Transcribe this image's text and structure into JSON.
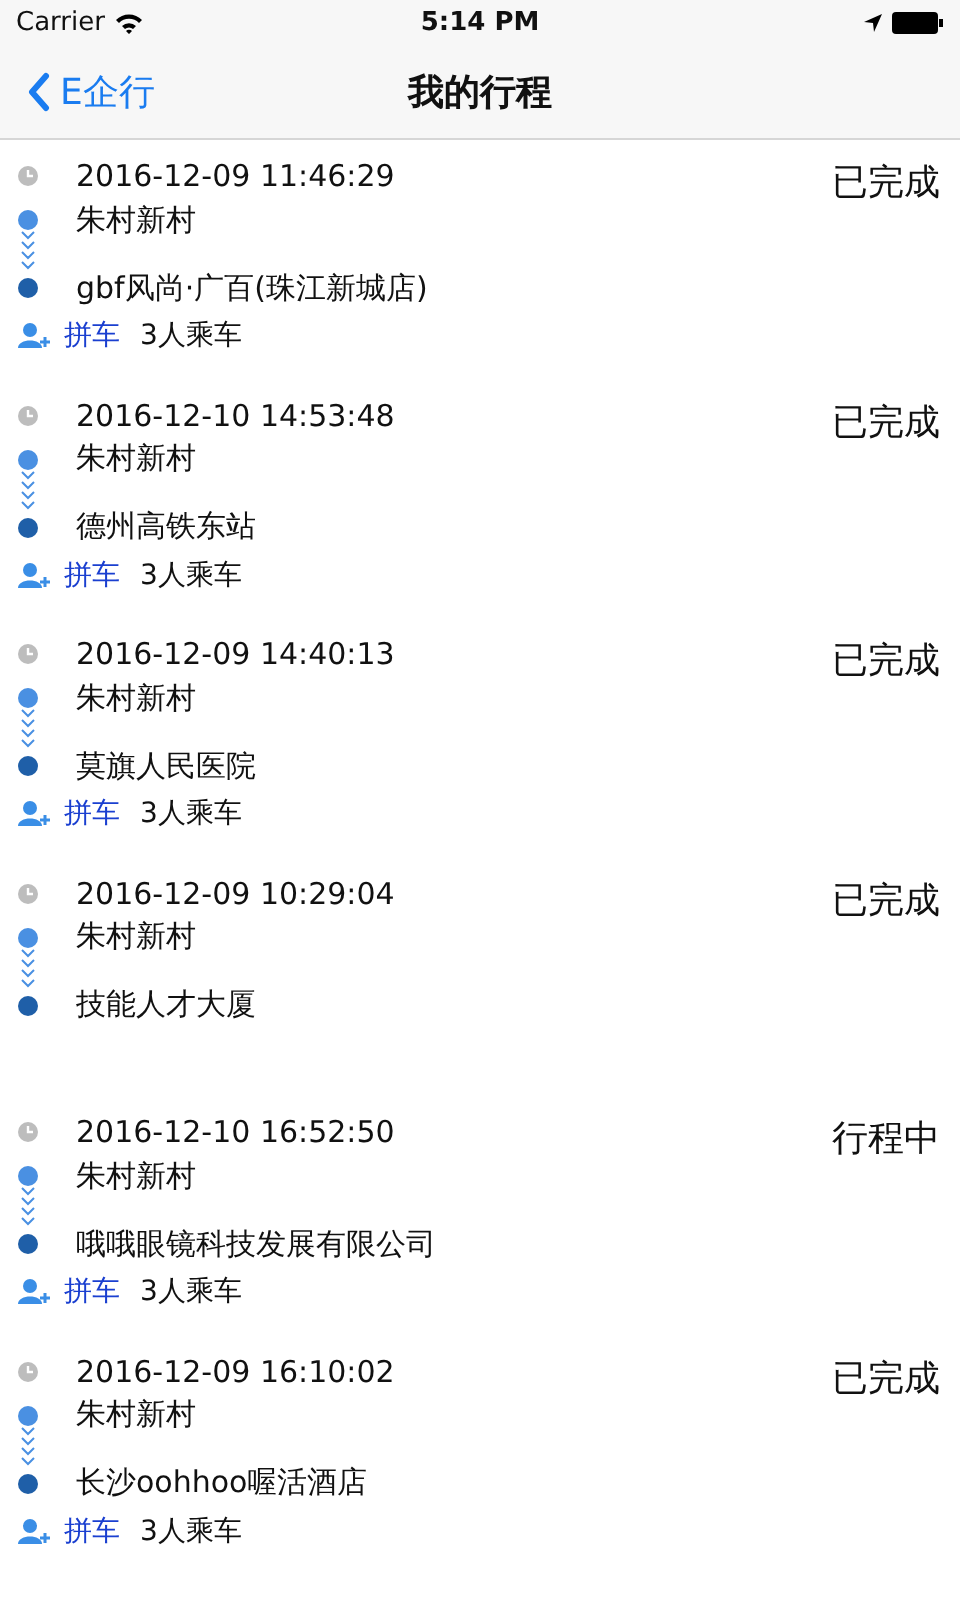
{
  "status_bar": {
    "carrier": "Carrier",
    "time": "5:14 PM"
  },
  "nav": {
    "back": "E企行",
    "title": "我的行程"
  },
  "trips": [
    {
      "time": "2016-12-09 11:46:29",
      "from": "朱村新村",
      "to": "gbf风尚·广百(珠江新城店)",
      "status": "已完成",
      "carpool": {
        "tag": "拼车",
        "seats": "3人乘车"
      }
    },
    {
      "time": "2016-12-10 14:53:48",
      "from": "朱村新村",
      "to": "德州高铁东站",
      "status": "已完成",
      "carpool": {
        "tag": "拼车",
        "seats": "3人乘车"
      }
    },
    {
      "time": "2016-12-09 14:40:13",
      "from": "朱村新村",
      "to": "莫旗人民医院",
      "status": "已完成",
      "carpool": {
        "tag": "拼车",
        "seats": "3人乘车"
      }
    },
    {
      "time": "2016-12-09 10:29:04",
      "from": "朱村新村",
      "to": "技能人才大厦",
      "status": "已完成"
    },
    {
      "time": "2016-12-10 16:52:50",
      "from": "朱村新村",
      "to": "哦哦眼镜科技发展有限公司",
      "status": "行程中",
      "carpool": {
        "tag": "拼车",
        "seats": "3人乘车"
      }
    },
    {
      "time": "2016-12-09 16:10:02",
      "from": "朱村新村",
      "to": "长沙oohhoo喔活酒店",
      "status": "已完成",
      "carpool": {
        "tag": "拼车",
        "seats": "3人乘车"
      }
    }
  ]
}
